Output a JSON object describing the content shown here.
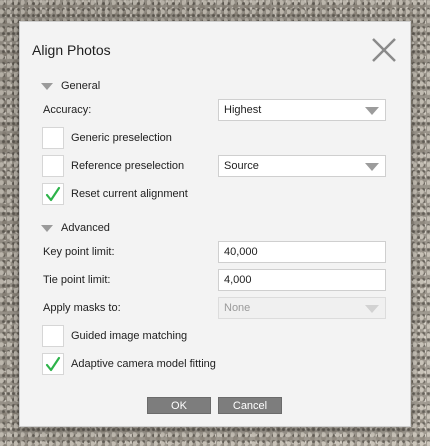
{
  "dialog": {
    "title": "Align Photos",
    "close_icon": "close-x-icon"
  },
  "general": {
    "header": "General",
    "accuracy_label": "Accuracy:",
    "accuracy_value": "Highest",
    "generic_preselection_label": "Generic preselection",
    "generic_preselection_checked": false,
    "reference_preselection_label": "Reference preselection",
    "reference_preselection_checked": false,
    "reference_source_value": "Source",
    "reset_alignment_label": "Reset current alignment",
    "reset_alignment_checked": true
  },
  "advanced": {
    "header": "Advanced",
    "key_point_limit_label": "Key point limit:",
    "key_point_limit_value": "40,000",
    "tie_point_limit_label": "Tie point limit:",
    "tie_point_limit_value": "4,000",
    "apply_masks_label": "Apply masks to:",
    "apply_masks_value": "None",
    "guided_matching_label": "Guided image matching",
    "guided_matching_checked": false,
    "adaptive_fitting_label": "Adaptive camera model fitting",
    "adaptive_fitting_checked": true
  },
  "buttons": {
    "ok": "OK",
    "cancel": "Cancel"
  },
  "colors": {
    "checkmark": "#2db34a",
    "button_bg": "#7d7d7d",
    "dialog_bg": "#f3f3f3"
  }
}
